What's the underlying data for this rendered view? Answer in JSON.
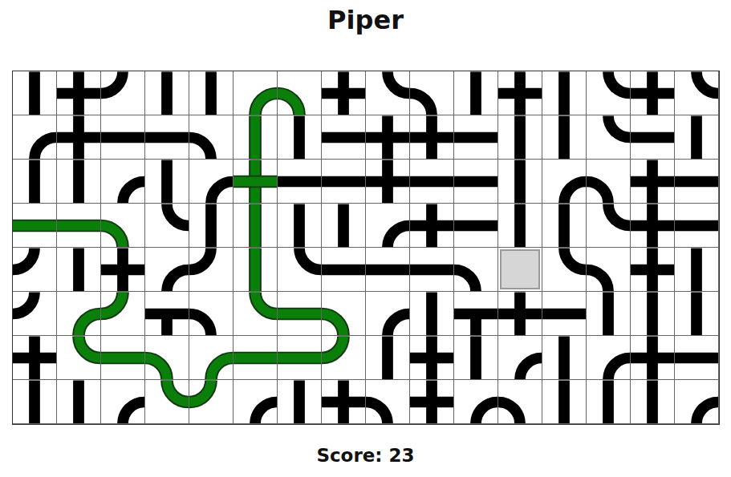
{
  "title": "Piper",
  "score": {
    "label": "Score: 23"
  },
  "board": {
    "rows": [
      [
        {
          "kind": "pipe",
          "links": "NS",
          "filled": false
        },
        {
          "kind": "pipe",
          "links": "NESW",
          "filled": false
        },
        {
          "kind": "pipe",
          "links": "NW",
          "filled": false
        },
        {
          "kind": "pipe",
          "links": "NS",
          "filled": false
        },
        {
          "kind": "pipe",
          "links": "NS",
          "filled": false
        },
        {
          "kind": "pipe",
          "links": "ES",
          "filled": true
        },
        {
          "kind": "pipe",
          "links": "SW",
          "filled": true
        },
        {
          "kind": "pipe",
          "links": "NESW",
          "filled": false
        },
        {
          "kind": "pipe",
          "links": "NE",
          "filled": false
        },
        {
          "kind": "pipe",
          "links": "SW",
          "filled": false
        },
        {
          "kind": "pipe",
          "links": "NS",
          "filled": false
        },
        {
          "kind": "pipe",
          "links": "NESW",
          "filled": false
        },
        {
          "kind": "pipe",
          "links": "NS",
          "filled": false
        },
        {
          "kind": "pipe",
          "links": "NE",
          "filled": false
        },
        {
          "kind": "pipe",
          "links": "NESW",
          "filled": false
        },
        {
          "kind": "pipe",
          "links": "NE",
          "filled": false
        }
      ],
      [
        {
          "kind": "pipe",
          "links": "ES",
          "filled": false
        },
        {
          "kind": "pipe",
          "links": "NESW",
          "filled": false
        },
        {
          "kind": "pipe",
          "links": "EW",
          "filled": false
        },
        {
          "kind": "pipe",
          "links": "EW",
          "filled": false
        },
        {
          "kind": "pipe",
          "links": "SW",
          "filled": false
        },
        {
          "kind": "pipe",
          "links": "NS",
          "filled": true
        },
        {
          "kind": "pipe",
          "links": "NS",
          "filled": false
        },
        {
          "kind": "pipe",
          "links": "EW",
          "filled": false
        },
        {
          "kind": "pipe",
          "links": "NESW",
          "filled": false
        },
        {
          "kind": "pipe",
          "links": "NESW",
          "filled": false
        },
        {
          "kind": "pipe",
          "links": "EW",
          "filled": false
        },
        {
          "kind": "pipe",
          "links": "NS",
          "filled": false
        },
        {
          "kind": "pipe",
          "links": "NS",
          "filled": false
        },
        {
          "kind": "pipe",
          "links": "NE",
          "filled": false
        },
        {
          "kind": "pipe",
          "links": "EW",
          "filled": false
        },
        {
          "kind": "pipe",
          "links": "NS",
          "filled": false
        }
      ],
      [
        {
          "kind": "pipe",
          "links": "NS",
          "filled": false
        },
        {
          "kind": "pipe",
          "links": "NS",
          "filled": false
        },
        {
          "kind": "pipe",
          "links": "ES",
          "filled": false
        },
        {
          "kind": "pipe",
          "links": "NS",
          "filled": false
        },
        {
          "kind": "pipe",
          "links": "ES",
          "filled": false
        },
        {
          "kind": "pipe",
          "links": "NESW",
          "filled": true
        },
        {
          "kind": "pipe",
          "links": "EW",
          "filled": false
        },
        {
          "kind": "pipe",
          "links": "EW",
          "filled": false
        },
        {
          "kind": "pipe",
          "links": "NESW",
          "filled": false
        },
        {
          "kind": "pipe",
          "links": "EW",
          "filled": false
        },
        {
          "kind": "pipe",
          "links": "EW",
          "filled": false
        },
        {
          "kind": "pipe",
          "links": "NS",
          "filled": false
        },
        {
          "kind": "pipe",
          "links": "ES",
          "filled": false
        },
        {
          "kind": "pipe",
          "links": "SW",
          "filled": false
        },
        {
          "kind": "pipe",
          "links": "NESW",
          "filled": false
        },
        {
          "kind": "pipe",
          "links": "EW",
          "filled": false
        }
      ],
      [
        {
          "kind": "pipe",
          "links": "EW",
          "filled": true
        },
        {
          "kind": "pipe",
          "links": "EW",
          "filled": true
        },
        {
          "kind": "pipe",
          "links": "SW",
          "filled": true
        },
        {
          "kind": "pipe",
          "links": "NE",
          "filled": false
        },
        {
          "kind": "pipe",
          "links": "NS",
          "filled": false
        },
        {
          "kind": "pipe",
          "links": "NS",
          "filled": true
        },
        {
          "kind": "pipe",
          "links": "NS",
          "filled": false
        },
        {
          "kind": "pipe",
          "links": "NS",
          "filled": false
        },
        {
          "kind": "pipe",
          "links": "ES",
          "filled": false
        },
        {
          "kind": "pipe",
          "links": "NESW",
          "filled": false
        },
        {
          "kind": "pipe",
          "links": "EW",
          "filled": false
        },
        {
          "kind": "pipe",
          "links": "NS",
          "filled": false
        },
        {
          "kind": "pipe",
          "links": "NS",
          "filled": false
        },
        {
          "kind": "pipe",
          "links": "NE",
          "filled": false
        },
        {
          "kind": "pipe",
          "links": "NESW",
          "filled": false
        },
        {
          "kind": "pipe",
          "links": "EW",
          "filled": false
        }
      ],
      [
        {
          "kind": "pipe",
          "links": "NW",
          "filled": false
        },
        {
          "kind": "pipe",
          "links": "NS",
          "filled": false
        },
        {
          "kind": "pipe",
          "links": "NESW",
          "filled": false
        },
        {
          "kind": "pipe",
          "links": "ES",
          "filled": false
        },
        {
          "kind": "pipe",
          "links": "NW",
          "filled": false
        },
        {
          "kind": "pipe",
          "links": "NS",
          "filled": true
        },
        {
          "kind": "pipe",
          "links": "NE",
          "filled": false
        },
        {
          "kind": "pipe",
          "links": "EW",
          "filled": false
        },
        {
          "kind": "pipe",
          "links": "EW",
          "filled": false
        },
        {
          "kind": "pipe",
          "links": "EW",
          "filled": false
        },
        {
          "kind": "pipe",
          "links": "SW",
          "filled": false
        },
        {
          "kind": "empty",
          "links": "",
          "filled": false
        },
        {
          "kind": "pipe",
          "links": "NE",
          "filled": false
        },
        {
          "kind": "pipe",
          "links": "SW",
          "filled": false
        },
        {
          "kind": "pipe",
          "links": "NESW",
          "filled": false
        },
        {
          "kind": "pipe",
          "links": "NS",
          "filled": false
        }
      ],
      [
        {
          "kind": "pipe",
          "links": "NW",
          "filled": false
        },
        {
          "kind": "pipe",
          "links": "ES",
          "filled": true
        },
        {
          "kind": "pipe",
          "links": "NW",
          "filled": true
        },
        {
          "kind": "pipe",
          "links": "ESW",
          "filled": false
        },
        {
          "kind": "pipe",
          "links": "SW",
          "filled": false
        },
        {
          "kind": "pipe",
          "links": "NE",
          "filled": true
        },
        {
          "kind": "pipe",
          "links": "EW",
          "filled": true
        },
        {
          "kind": "pipe",
          "links": "SW",
          "filled": true
        },
        {
          "kind": "pipe",
          "links": "ES",
          "filled": false
        },
        {
          "kind": "pipe",
          "links": "NS",
          "filled": false
        },
        {
          "kind": "pipe",
          "links": "ESW",
          "filled": false
        },
        {
          "kind": "pipe",
          "links": "NESW",
          "filled": false
        },
        {
          "kind": "pipe",
          "links": "EW",
          "filled": false
        },
        {
          "kind": "pipe",
          "links": "NS",
          "filled": false
        },
        {
          "kind": "pipe",
          "links": "NS",
          "filled": false
        },
        {
          "kind": "pipe",
          "links": "NS",
          "filled": false
        }
      ],
      [
        {
          "kind": "pipe",
          "links": "NESW",
          "filled": false
        },
        {
          "kind": "pipe",
          "links": "NE",
          "filled": true
        },
        {
          "kind": "pipe",
          "links": "EW",
          "filled": true
        },
        {
          "kind": "pipe",
          "links": "SW",
          "filled": true
        },
        {
          "kind": "pipe",
          "links": "ES",
          "filled": true
        },
        {
          "kind": "pipe",
          "links": "EW",
          "filled": true
        },
        {
          "kind": "pipe",
          "links": "EW",
          "filled": true
        },
        {
          "kind": "pipe",
          "links": "NW",
          "filled": true
        },
        {
          "kind": "pipe",
          "links": "NS",
          "filled": false
        },
        {
          "kind": "pipe",
          "links": "NESW",
          "filled": false
        },
        {
          "kind": "pipe",
          "links": "NS",
          "filled": false
        },
        {
          "kind": "pipe",
          "links": "ES",
          "filled": false
        },
        {
          "kind": "pipe",
          "links": "NS",
          "filled": false
        },
        {
          "kind": "pipe",
          "links": "ES",
          "filled": false
        },
        {
          "kind": "pipe",
          "links": "NESW",
          "filled": false
        },
        {
          "kind": "pipe",
          "links": "EW",
          "filled": false
        }
      ],
      [
        {
          "kind": "pipe",
          "links": "NS",
          "filled": false
        },
        {
          "kind": "pipe",
          "links": "NS",
          "filled": false
        },
        {
          "kind": "pipe",
          "links": "ES",
          "filled": false
        },
        {
          "kind": "pipe",
          "links": "NE",
          "filled": true
        },
        {
          "kind": "pipe",
          "links": "NW",
          "filled": true
        },
        {
          "kind": "pipe",
          "links": "ES",
          "filled": false
        },
        {
          "kind": "pipe",
          "links": "NS",
          "filled": false
        },
        {
          "kind": "pipe",
          "links": "NESW",
          "filled": false
        },
        {
          "kind": "pipe",
          "links": "SW",
          "filled": false
        },
        {
          "kind": "pipe",
          "links": "NESW",
          "filled": false
        },
        {
          "kind": "pipe",
          "links": "ES",
          "filled": false
        },
        {
          "kind": "pipe",
          "links": "SW",
          "filled": false
        },
        {
          "kind": "pipe",
          "links": "NS",
          "filled": false
        },
        {
          "kind": "pipe",
          "links": "NS",
          "filled": false
        },
        {
          "kind": "pipe",
          "links": "NS",
          "filled": false
        },
        {
          "kind": "pipe",
          "links": "ES",
          "filled": false
        }
      ]
    ]
  }
}
